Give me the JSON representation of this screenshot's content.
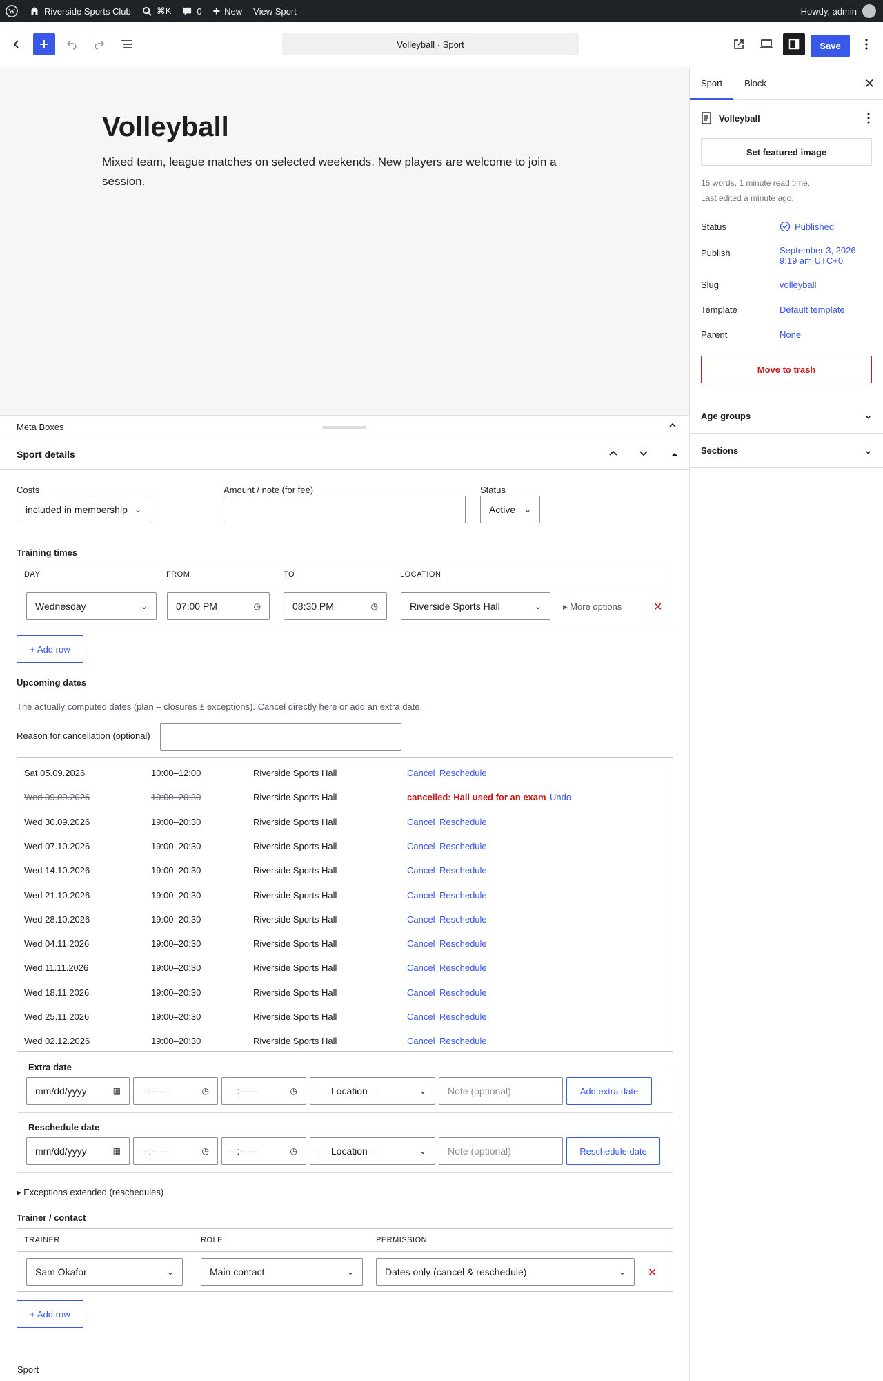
{
  "admin_bar": {
    "site": "Riverside Sports Club",
    "search": "⌘K",
    "comments": "0",
    "new": "New",
    "view": "View Sport",
    "howdy": "Howdy, admin"
  },
  "toolbar": {
    "document_title": "Volleyball · Sport",
    "save": "Save"
  },
  "post": {
    "title": "Volleyball",
    "content": "Mixed team, league matches on selected weekends. New players are welcome to join a session."
  },
  "sidebar": {
    "tab_post": "Sport",
    "tab_block": "Block",
    "doc_name": "Volleyball",
    "featured": "Set featured image",
    "stats1": "15 words, 1 minute read time.",
    "stats2": "Last edited a minute ago.",
    "status_label": "Status",
    "status_value": "Published",
    "publish_label": "Publish",
    "publish_value1": "September 3, 2026",
    "publish_value2": "9:19 am UTC+0",
    "slug_label": "Slug",
    "slug_value": "volleyball",
    "template_label": "Template",
    "template_value": "Default template",
    "parent_label": "Parent",
    "parent_value": "None",
    "trash": "Move to trash",
    "panel1": "Age groups",
    "panel2": "Sections"
  },
  "meta": {
    "header": "Meta Boxes",
    "box_title": "Sport details",
    "costs_label": "Costs",
    "costs_value": "included in membership",
    "amount_label": "Amount / note (for fee)",
    "status_label": "Status",
    "status_value": "Active",
    "training_label": "Training times",
    "training_headers": {
      "day": "DAY",
      "from": "FROM",
      "to": "TO",
      "location": "LOCATION"
    },
    "training_row": {
      "day": "Wednesday",
      "from": "07:00 PM",
      "to": "08:30 PM",
      "location": "Riverside Sports Hall",
      "more": "▸ More options"
    },
    "add_row": "+ Add row",
    "upcoming_label": "Upcoming dates",
    "upcoming_desc": "The actually computed dates (plan – closures ± exceptions). Cancel directly here or add an extra date.",
    "reason_label": "Reason for cancellation (optional)",
    "dates": [
      {
        "date": "Sat 05.09.2026",
        "time": "10:00–12:00",
        "loc": "Riverside Sports Hall",
        "status": ""
      },
      {
        "date": "Wed 09.09.2026",
        "time": "19:00–20:30",
        "loc": "Riverside Sports Hall",
        "status": "cancelled: Hall used for an exam"
      },
      {
        "date": "Wed 30.09.2026",
        "time": "19:00–20:30",
        "loc": "Riverside Sports Hall",
        "status": ""
      },
      {
        "date": "Wed 07.10.2026",
        "time": "19:00–20:30",
        "loc": "Riverside Sports Hall",
        "status": ""
      },
      {
        "date": "Wed 14.10.2026",
        "time": "19:00–20:30",
        "loc": "Riverside Sports Hall",
        "status": ""
      },
      {
        "date": "Wed 21.10.2026",
        "time": "19:00–20:30",
        "loc": "Riverside Sports Hall",
        "status": ""
      },
      {
        "date": "Wed 28.10.2026",
        "time": "19:00–20:30",
        "loc": "Riverside Sports Hall",
        "status": ""
      },
      {
        "date": "Wed 04.11.2026",
        "time": "19:00–20:30",
        "loc": "Riverside Sports Hall",
        "status": ""
      },
      {
        "date": "Wed 11.11.2026",
        "time": "19:00–20:30",
        "loc": "Riverside Sports Hall",
        "status": ""
      },
      {
        "date": "Wed 18.11.2026",
        "time": "19:00–20:30",
        "loc": "Riverside Sports Hall",
        "status": ""
      },
      {
        "date": "Wed 25.11.2026",
        "time": "19:00–20:30",
        "loc": "Riverside Sports Hall",
        "status": ""
      },
      {
        "date": "Wed 02.12.2026",
        "time": "19:00–20:30",
        "loc": "Riverside Sports Hall",
        "status": ""
      }
    ],
    "cancel": "Cancel",
    "reschedule": "Reschedule",
    "undo": "Undo",
    "extra_label": "Extra date",
    "reschedule_label": "Reschedule date",
    "date_placeholder": "mm/dd/yyyy",
    "time_placeholder": "--:-- --",
    "location_placeholder": "— Location —",
    "note_placeholder": "Note (optional)",
    "add_extra": "Add extra date",
    "reschedule_btn": "Reschedule date",
    "exceptions": "▸ Exceptions extended (reschedules)",
    "trainer_label": "Trainer / contact",
    "trainer_headers": {
      "trainer": "TRAINER",
      "role": "ROLE",
      "permission": "PERMISSION"
    },
    "trainer_row": {
      "trainer": "Sam Okafor",
      "role": "Main contact",
      "permission": "Dates only (cancel & reschedule)"
    },
    "footer": "Sport"
  }
}
